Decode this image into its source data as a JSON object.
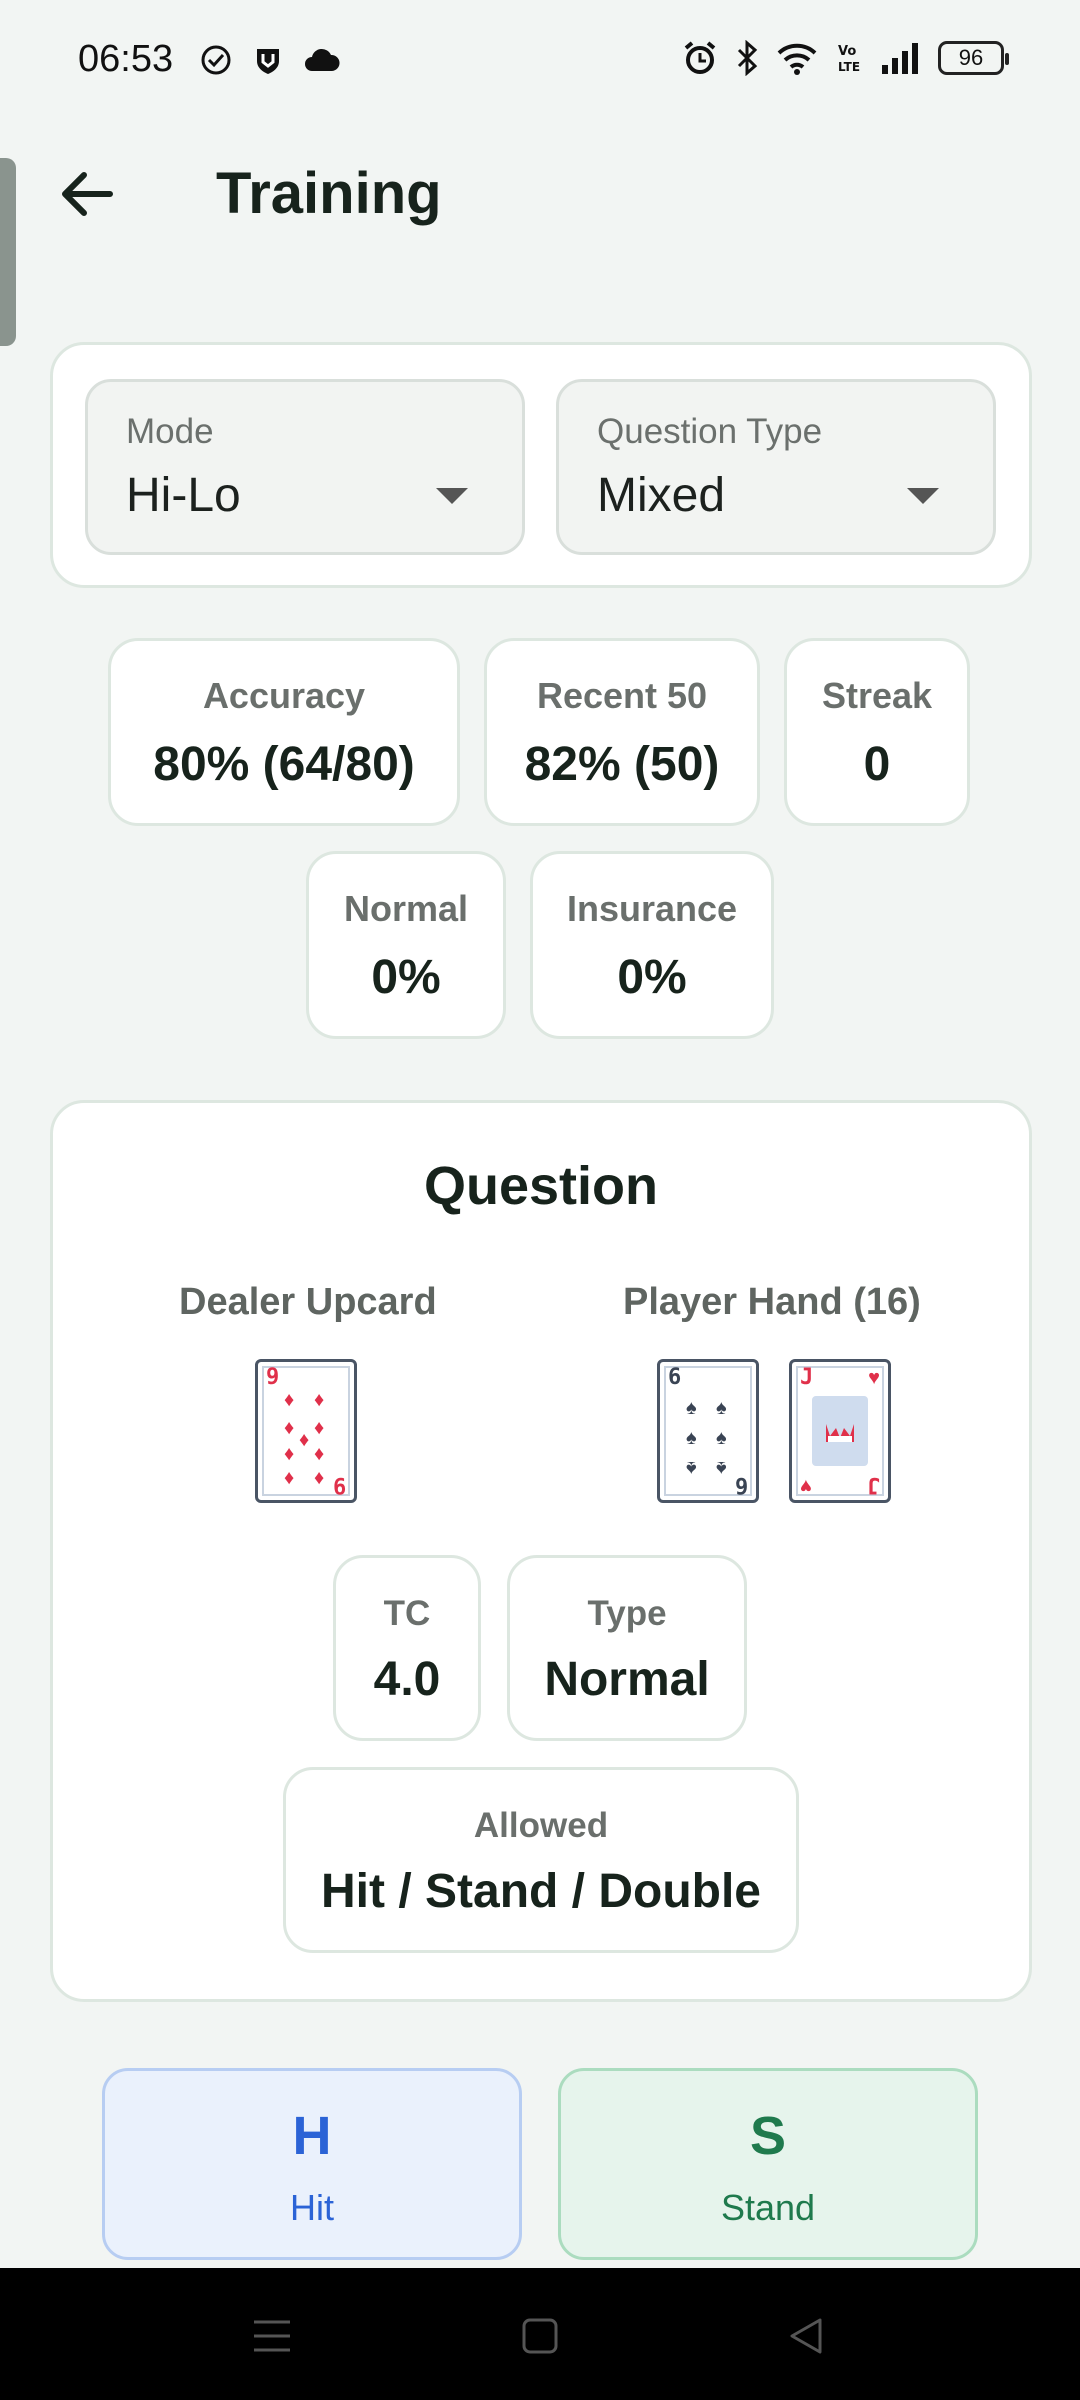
{
  "status_bar": {
    "time": "06:53",
    "battery": "96"
  },
  "header": {
    "title": "Training"
  },
  "settings": {
    "mode": {
      "label": "Mode",
      "value": "Hi-Lo"
    },
    "question_type": {
      "label": "Question Type",
      "value": "Mixed"
    }
  },
  "stats": {
    "accuracy": {
      "label": "Accuracy",
      "value": "80% (64/80)"
    },
    "recent": {
      "label": "Recent 50",
      "value": "82% (50)"
    },
    "streak": {
      "label": "Streak",
      "value": "0"
    },
    "normal": {
      "label": "Normal",
      "value": "0%"
    },
    "insurance": {
      "label": "Insurance",
      "value": "0%"
    }
  },
  "question": {
    "title": "Question",
    "dealer_label": "Dealer Upcard",
    "player_label": "Player Hand (16)",
    "dealer_card": {
      "rank": "9",
      "suit": "diamonds"
    },
    "player_cards": [
      {
        "rank": "6",
        "suit": "spades"
      },
      {
        "rank": "J",
        "suit": "hearts"
      }
    ],
    "tc": {
      "label": "TC",
      "value": "4.0"
    },
    "type": {
      "label": "Type",
      "value": "Normal"
    },
    "allowed": {
      "label": "Allowed",
      "value": "Hit / Stand / Double"
    }
  },
  "actions": {
    "hit": {
      "key": "H",
      "label": "Hit",
      "color": "#2b63d6"
    },
    "stand": {
      "key": "S",
      "label": "Stand",
      "color": "#1f7a4d"
    }
  }
}
